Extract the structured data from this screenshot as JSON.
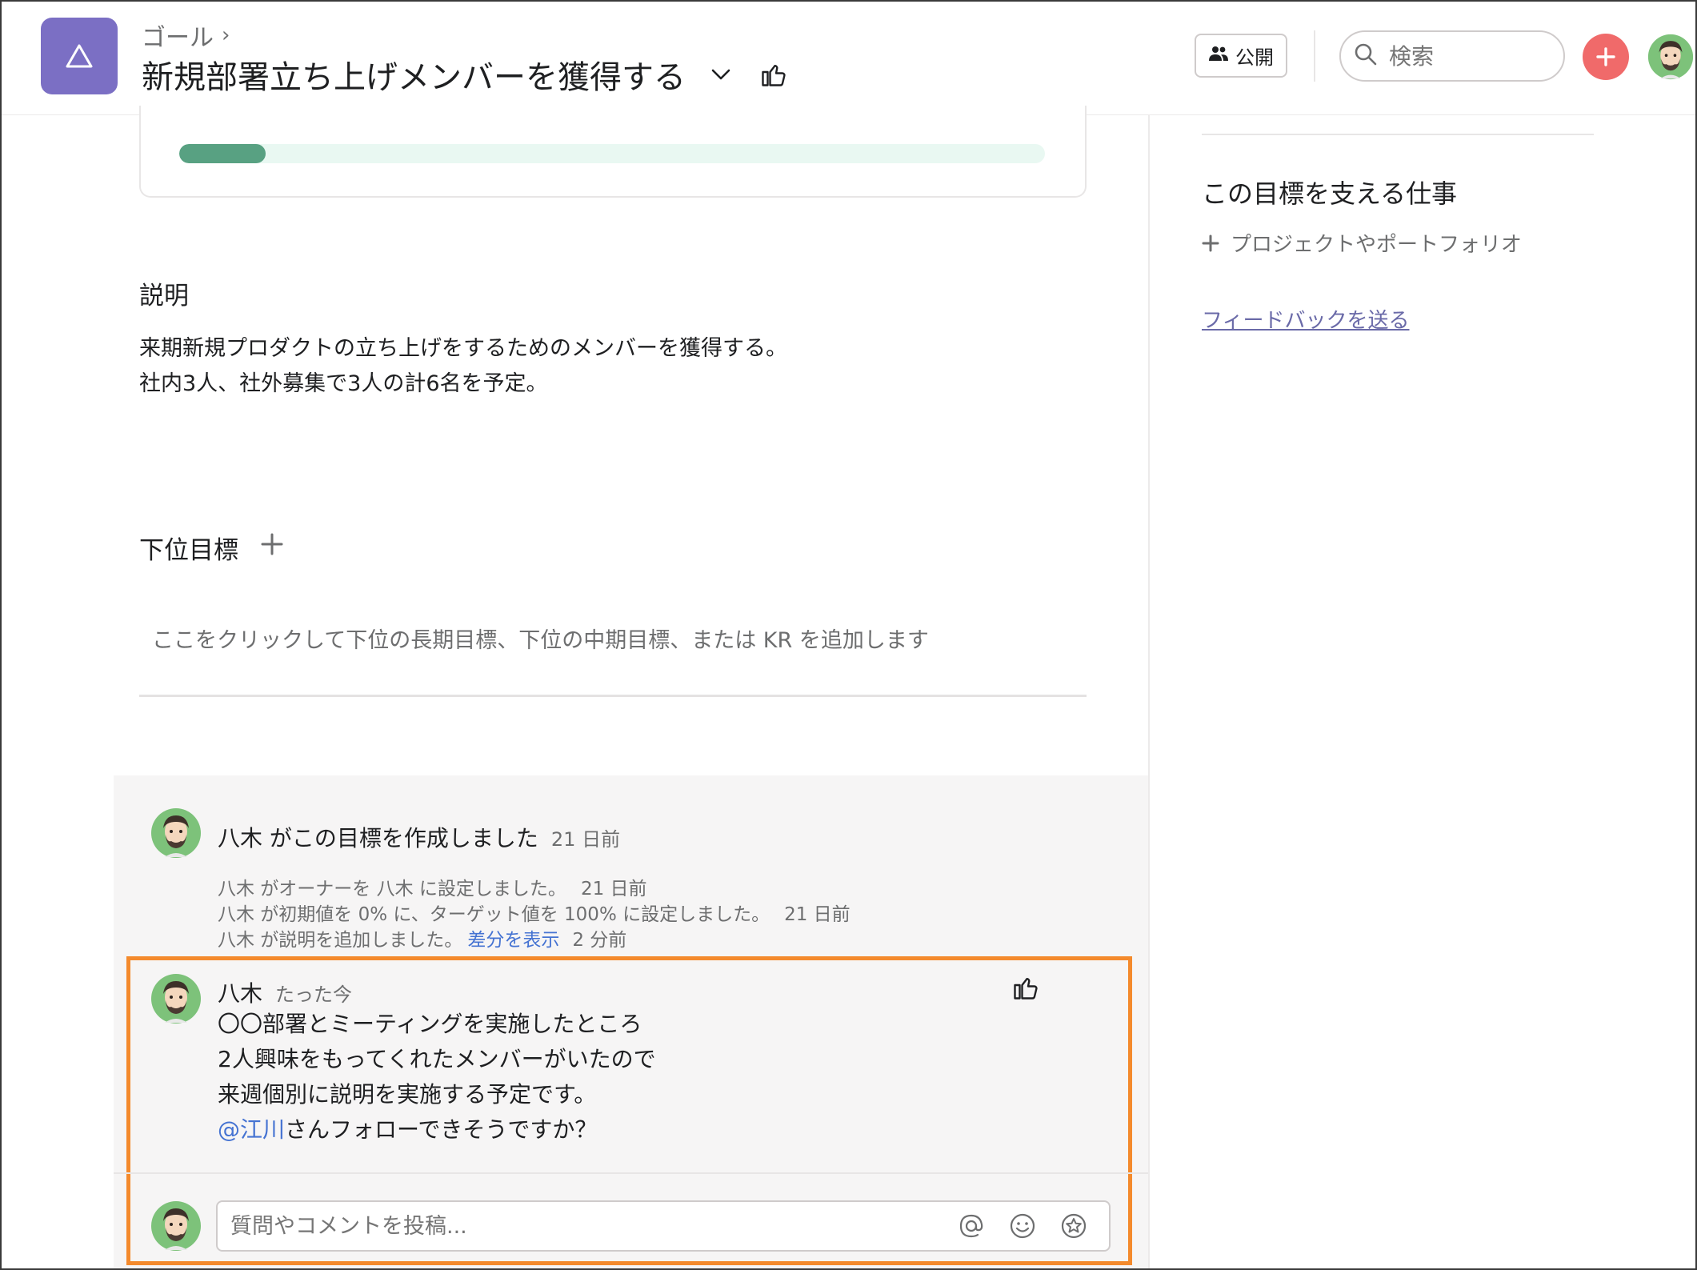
{
  "header": {
    "breadcrumb": "ゴール",
    "breadcrumb_chevron": "›",
    "title": "新規部署立ち上げメンバーを獲得する",
    "public_button": "公開",
    "search_placeholder": "検索"
  },
  "progress": {
    "value": 0.1
  },
  "description": {
    "heading": "説明",
    "line1": "来期新規プロダクトの立ち上げをするためのメンバーを獲得する。",
    "line2": "社内3人、社外募集で3人の計6名を予定。"
  },
  "subgoals": {
    "heading": "下位目標",
    "placeholder": "ここをクリックして下位の長期目標、下位の中期目標、または KR を追加します"
  },
  "right_panel": {
    "title": "この目標を支える仕事",
    "add_label": "プロジェクトやポートフォリオ",
    "feedback_link": "フィードバックを送る"
  },
  "activity": {
    "created_text": "八木 がこの目標を作成しました",
    "created_time": "21 日前",
    "events": [
      {
        "text": "八木 がオーナーを 八木 に設定しました。",
        "link": "",
        "time": "21 日前"
      },
      {
        "text": "八木 が初期値を 0% に、ターゲット値を 100% に設定しました。",
        "link": "",
        "time": "21 日前"
      },
      {
        "text": "八木 が説明を追加しました。",
        "link": "差分を表示",
        "time": "2 分前"
      }
    ],
    "comment": {
      "author": "八木",
      "time": "たった今",
      "line1": "〇〇部署とミーティングを実施したところ",
      "line2": "2人興味をもってくれたメンバーがいたので",
      "line3": "来週個別に説明を実施する予定です。",
      "mention": "@江川",
      "line4_rest": "さんフォローできそうですか？"
    },
    "composer_placeholder": "質問やコメントを投稿..."
  },
  "colors": {
    "goal_icon": "#7b6fc4",
    "progress_fill": "#58a182",
    "progress_track": "#e9f8f2",
    "add_button": "#f06a6a",
    "link": "#4573d2",
    "highlight_border": "#f48a2c"
  },
  "icons": [
    "goal-triangle-icon",
    "chevron-right-icon",
    "chevron-down-icon",
    "thumbs-up-icon",
    "people-icon",
    "search-icon",
    "plus-icon",
    "avatar",
    "at-mention-icon",
    "emoji-icon",
    "star-icon"
  ]
}
